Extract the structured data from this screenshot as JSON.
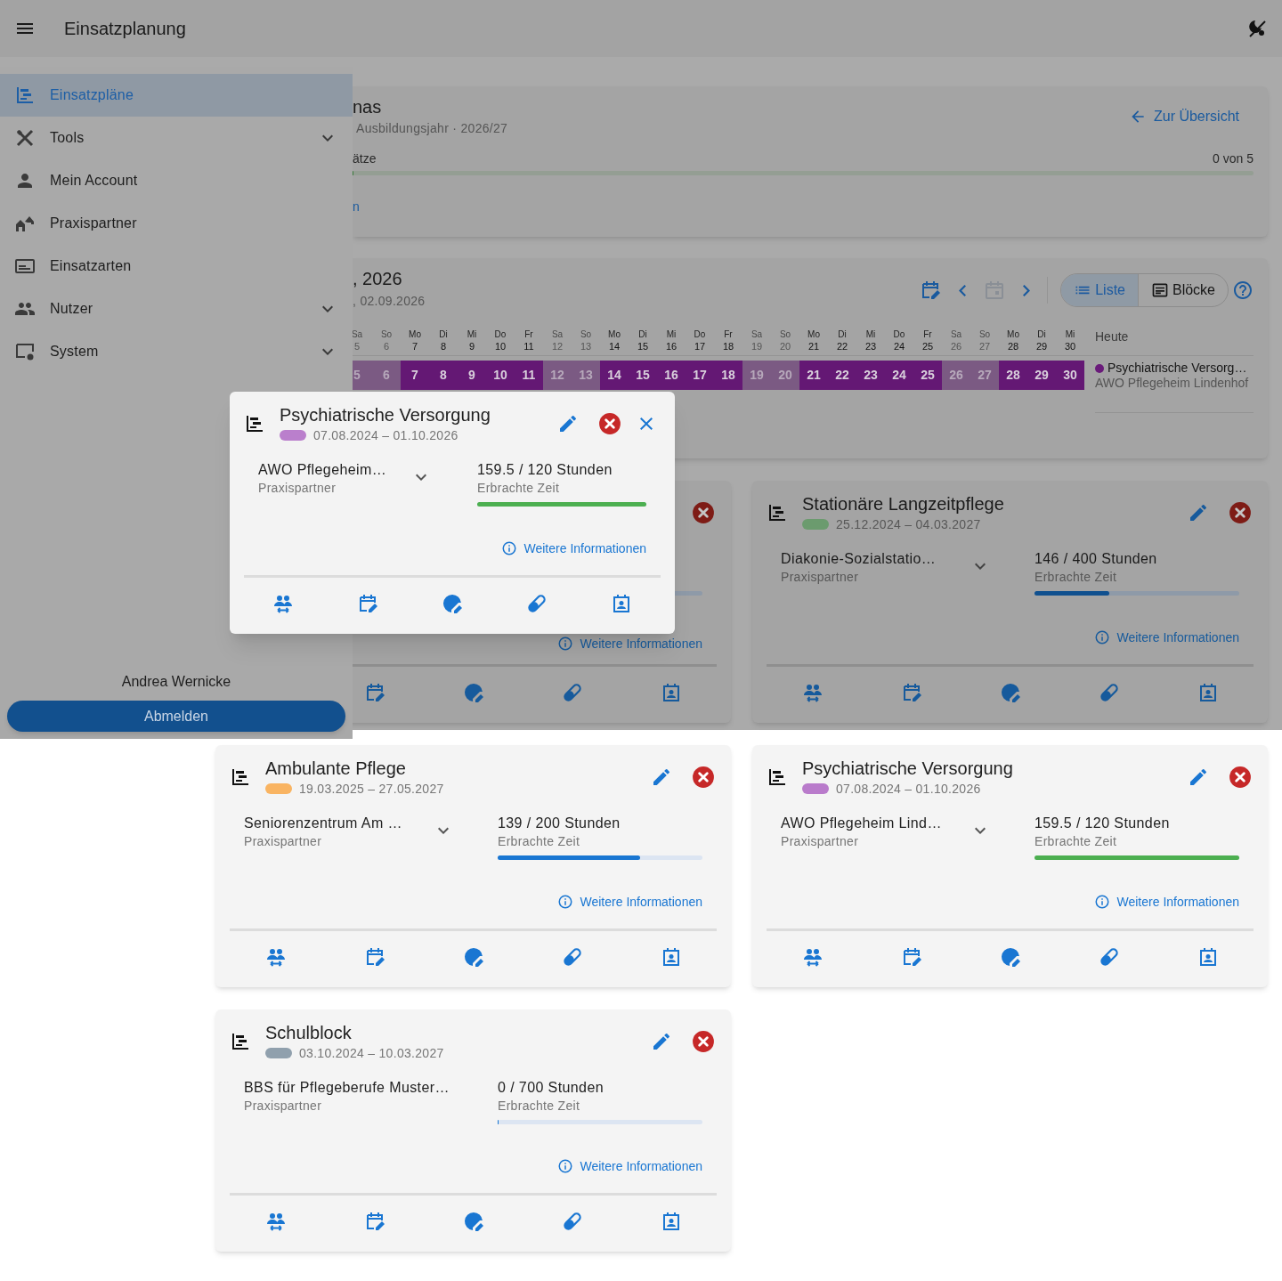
{
  "app_bar": {
    "title": "Einsatzplanung"
  },
  "drawer": {
    "items": [
      {
        "label": "Einsatzpläne",
        "selected": true,
        "expandable": false
      },
      {
        "label": "Tools",
        "selected": false,
        "expandable": true
      },
      {
        "label": "Mein Account",
        "selected": false,
        "expandable": false
      },
      {
        "label": "Praxispartner",
        "selected": false,
        "expandable": false
      },
      {
        "label": "Einsatzarten",
        "selected": false,
        "expandable": false
      },
      {
        "label": "Nutzer",
        "selected": false,
        "expandable": true
      },
      {
        "label": "System",
        "selected": false,
        "expandable": true
      }
    ],
    "user": "Andrea Wernicke",
    "logout": "Abmelden"
  },
  "overview": {
    "title": "nas",
    "subtitle": "Ausbildungsjahr · 2026/27",
    "back_link": "Zur Übersicht",
    "progress_label": "ätze",
    "progress_count": "0 von 5",
    "level": 0,
    "link": "n"
  },
  "calendar": {
    "title": ", 2026",
    "subtitle": ", 02.09.2026",
    "today_button": {
      "disabled": true
    },
    "view_toggle": [
      {
        "label": "Liste",
        "selected": true
      },
      {
        "label": "Blöcke",
        "selected": false
      }
    ],
    "days": [
      {
        "weekday": "Sa",
        "day": "5",
        "bar": "5",
        "weekend": true
      },
      {
        "weekday": "So",
        "day": "6",
        "bar": "6",
        "weekend": true
      },
      {
        "weekday": "Mo",
        "day": "7",
        "bar": "7",
        "weekend": false
      },
      {
        "weekday": "Di",
        "day": "8",
        "bar": "8",
        "weekend": false
      },
      {
        "weekday": "Mi",
        "day": "9",
        "bar": "9",
        "weekend": false
      },
      {
        "weekday": "Do",
        "day": "10",
        "bar": "10",
        "weekend": false
      },
      {
        "weekday": "Fr",
        "day": "11",
        "bar": "11",
        "weekend": false
      },
      {
        "weekday": "Sa",
        "day": "12",
        "bar": "12",
        "weekend": true
      },
      {
        "weekday": "So",
        "day": "13",
        "bar": "13",
        "weekend": true
      },
      {
        "weekday": "Mo",
        "day": "14",
        "bar": "14",
        "weekend": false
      },
      {
        "weekday": "Di",
        "day": "15",
        "bar": "15",
        "weekend": false
      },
      {
        "weekday": "Mi",
        "day": "16",
        "bar": "16",
        "weekend": false
      },
      {
        "weekday": "Do",
        "day": "17",
        "bar": "17",
        "weekend": false
      },
      {
        "weekday": "Fr",
        "day": "18",
        "bar": "18",
        "weekend": false
      },
      {
        "weekday": "Sa",
        "day": "19",
        "bar": "19",
        "weekend": true
      },
      {
        "weekday": "So",
        "day": "20",
        "bar": "20",
        "weekend": true
      },
      {
        "weekday": "Mo",
        "day": "21",
        "bar": "21",
        "weekend": false
      },
      {
        "weekday": "Di",
        "day": "22",
        "bar": "22",
        "weekend": false
      },
      {
        "weekday": "Mi",
        "day": "23",
        "bar": "23",
        "weekend": false
      },
      {
        "weekday": "Do",
        "day": "24",
        "bar": "24",
        "weekend": false
      },
      {
        "weekday": "Fr",
        "day": "25",
        "bar": "25",
        "weekend": false
      },
      {
        "weekday": "Sa",
        "day": "26",
        "bar": "26",
        "weekend": true
      },
      {
        "weekday": "So",
        "day": "27",
        "bar": "27",
        "weekend": true
      },
      {
        "weekday": "Mo",
        "day": "28",
        "bar": "28",
        "weekend": false
      },
      {
        "weekday": "Di",
        "day": "29",
        "bar": "29",
        "weekend": false
      },
      {
        "weekday": "Mi",
        "day": "30",
        "bar": "30",
        "weekend": false
      }
    ],
    "today_label": "Heute",
    "legend": [
      {
        "title": "Psychiatrische Versorg…",
        "partner": "AWO Pflegeheim Lindenhof",
        "color": "#6a1b7a"
      }
    ]
  },
  "popup": {
    "title": "Psychiatrische Versorgung",
    "color": "#ba7fcc",
    "dates": "07.08.2024 – 01.10.2026",
    "partner": "AWO Pflegeheim…",
    "partner_label": "Praxispartner",
    "expandable": true,
    "hours": "159.5 / 120 Stunden",
    "hours_label": "Erbrachte Zeit",
    "level": 1,
    "complete": true,
    "info_link": "Weitere Informationen"
  },
  "covered_card": {
    "info_link": "Weitere Informationen"
  },
  "cards": [
    {
      "title": "Stationäre Langzeitpflege",
      "color": "#6b9b6e",
      "dates": "25.12.2024 – 04.03.2027",
      "partner": "Diakonie-Sozialstatio…",
      "partner_label": "Praxispartner",
      "expandable": true,
      "hours": "146 / 400 Stunden",
      "hours_label": "Erbrachte Zeit",
      "level": 0.365,
      "complete": false,
      "info_link": "Weitere Informationen"
    },
    {
      "title": "Ambulante Pflege",
      "color": "#f9b462",
      "dates": "19.03.2025 – 27.05.2027",
      "partner": "Seniorenzentrum Am …",
      "partner_label": "Praxispartner",
      "expandable": true,
      "hours": "139 / 200 Stunden",
      "hours_label": "Erbrachte Zeit",
      "level": 0.695,
      "complete": false,
      "info_link": "Weitere Informationen"
    },
    {
      "title": "Psychiatrische Versorgung",
      "color": "#b97bcb",
      "dates": "07.08.2024 – 01.10.2026",
      "partner": "AWO Pflegeheim Lind…",
      "partner_label": "Praxispartner",
      "expandable": true,
      "hours": "159.5 / 120 Stunden",
      "hours_label": "Erbrachte Zeit",
      "level": 1,
      "complete": true,
      "info_link": "Weitere Informationen"
    },
    {
      "title": "Schulblock",
      "color": "#90a0ad",
      "dates": "03.10.2024 – 10.03.2027",
      "partner": "BBS für Pflegeberufe Muster…",
      "partner_label": "Praxispartner",
      "expandable": false,
      "hours": "0 / 700 Stunden",
      "hours_label": "Erbrachte Zeit",
      "level": 0,
      "complete": false,
      "info_link": "Weitere Informationen"
    }
  ]
}
